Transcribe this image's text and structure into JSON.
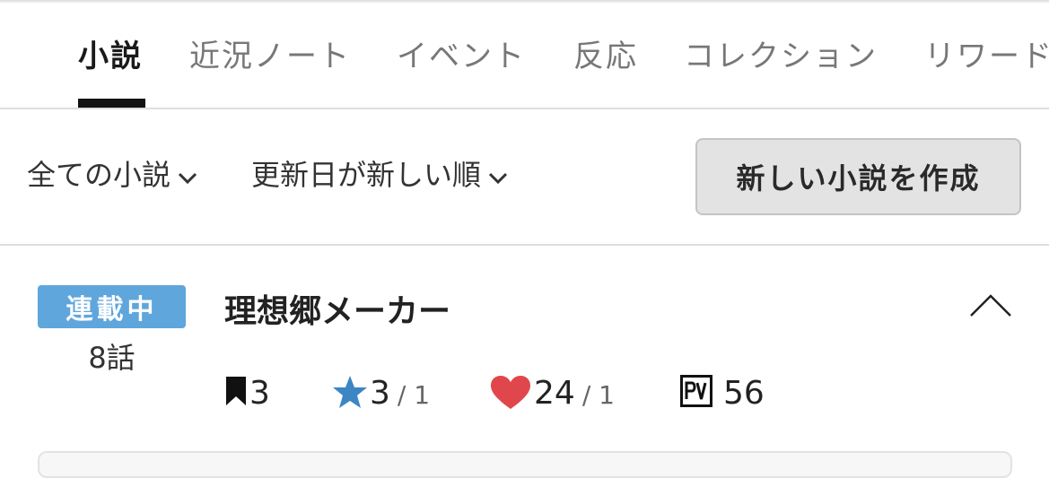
{
  "tabs": [
    {
      "label": "小説",
      "active": true
    },
    {
      "label": "近況ノート",
      "active": false
    },
    {
      "label": "イベント",
      "active": false
    },
    {
      "label": "反応",
      "active": false
    },
    {
      "label": "コレクション",
      "active": false
    },
    {
      "label": "リワード",
      "active": false
    }
  ],
  "filters": {
    "scope_label": "全ての小説",
    "sort_label": "更新日が新しい順"
  },
  "actions": {
    "create_label": "新しい小説を作成"
  },
  "novel": {
    "status": "連載中",
    "episodes": "8話",
    "title": "理想郷メーカー",
    "bookmarks": "3",
    "stars": "3",
    "stars_sub": "/ 1",
    "hearts": "24",
    "hearts_sub": "/ 1",
    "pv": "56"
  },
  "colors": {
    "status_badge": "#5fa6dc",
    "star": "#3c86c4",
    "heart": "#e0474c",
    "active_tab_underline": "#111111"
  }
}
